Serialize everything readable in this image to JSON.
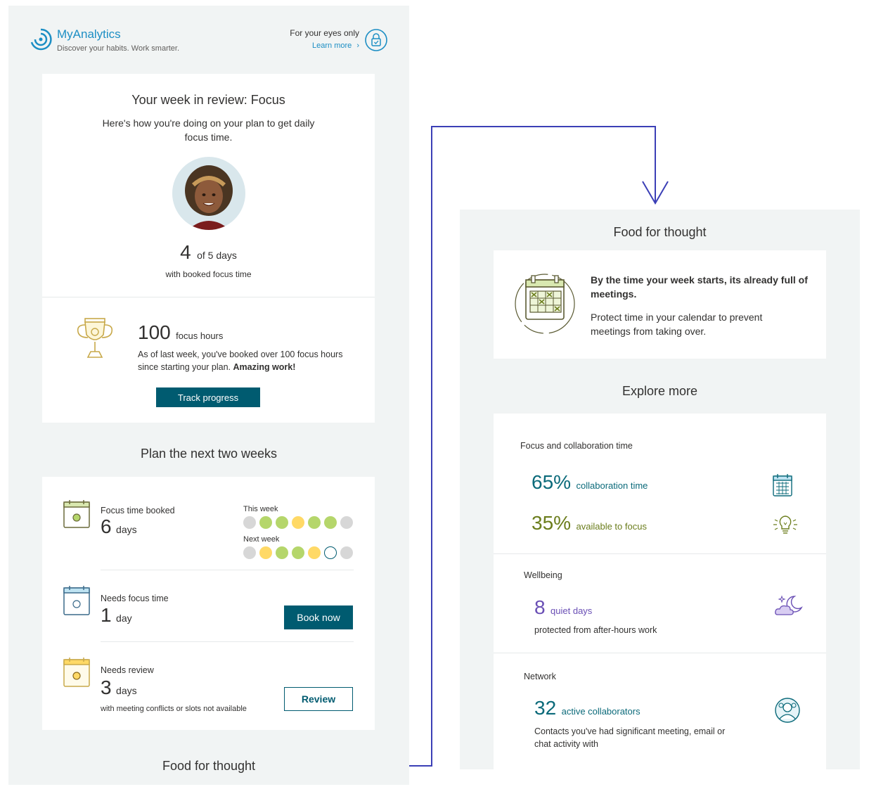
{
  "header": {
    "app_name": "MyAnalytics",
    "tagline": "Discover your habits. Work smarter.",
    "privacy_label": "For your eyes only",
    "learn_more": "Learn more",
    "learn_more_chevron": "›"
  },
  "review": {
    "title": "Your week in review: Focus",
    "subtitle": "Here's how you're doing on your plan to get daily focus time.",
    "days_value": "4",
    "days_suffix": "of 5 days",
    "days_caption": "with booked focus time"
  },
  "hours": {
    "value": "100",
    "unit": "focus hours",
    "text": "As of last week, you've booked over 100 focus hours since starting your plan.",
    "emphasis": "Amazing work!",
    "button": "Track progress"
  },
  "plan": {
    "title": "Plan the next two weeks",
    "focus_booked": {
      "label": "Focus time booked",
      "value": "6",
      "unit": "days",
      "this_week_label": "This week",
      "next_week_label": "Next week",
      "this_week": [
        "none",
        "booked",
        "booked",
        "conflict",
        "booked",
        "booked",
        "none"
      ],
      "next_week": [
        "none",
        "conflict",
        "booked",
        "booked",
        "conflict",
        "needs",
        "none"
      ]
    },
    "needs_focus": {
      "label": "Needs focus time",
      "value": "1",
      "unit": "day",
      "button": "Book now"
    },
    "needs_review": {
      "label": "Needs review",
      "value": "3",
      "unit": "days",
      "caption": "with meeting conflicts or slots not available",
      "button": "Review"
    }
  },
  "footer_left": {
    "title": "Food for thought"
  },
  "food": {
    "title": "Food for thought",
    "headline": "By the time your week starts, its already full of meetings.",
    "text": "Protect time in your calendar to prevent meetings from taking over."
  },
  "explore": {
    "title": "Explore more",
    "collab": {
      "label": "Focus and collaboration time",
      "collab_value": "65%",
      "collab_unit": "collaboration time",
      "focus_value": "35%",
      "focus_unit": "available to focus"
    },
    "wellbeing": {
      "label": "Wellbeing",
      "value": "8",
      "unit": "quiet days",
      "caption": "protected from after-hours work"
    },
    "network": {
      "label": "Network",
      "value": "32",
      "unit": "active collaborators",
      "caption": "Contacts you've had significant meeting, email or chat activity with"
    }
  },
  "colors": {
    "teal": "#0b6a7a",
    "button": "#005b70",
    "olive": "#6b7d1c",
    "booked": "#b5d66b",
    "conflict": "#ffd966",
    "none": "#d7d7d7",
    "connector": "#3b3fb6"
  },
  "icons": [
    "myanalytics-logo-icon",
    "lock-icon",
    "avatar",
    "trophy-icon",
    "calendar-icon",
    "calendar-grid-icon",
    "lightbulb-icon",
    "moon-icon",
    "people-icon"
  ]
}
